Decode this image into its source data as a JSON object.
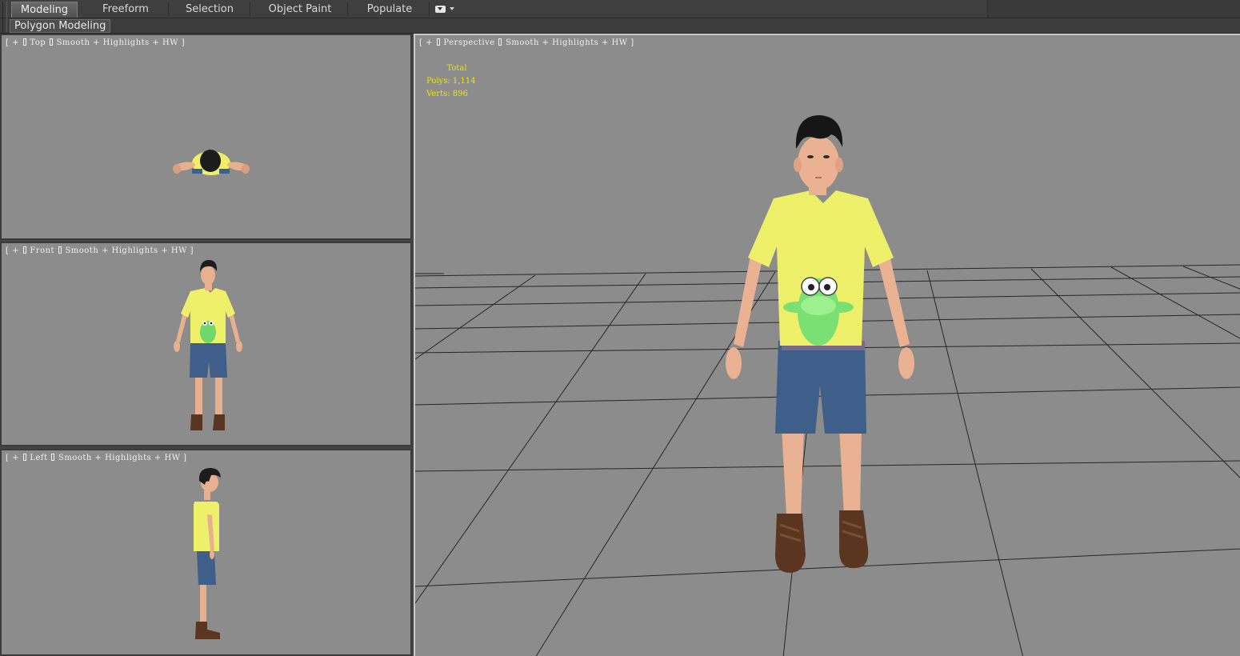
{
  "ribbon": {
    "tabs": [
      {
        "label": "Modeling",
        "active": true
      },
      {
        "label": "Freeform",
        "active": false
      },
      {
        "label": "Selection",
        "active": false
      },
      {
        "label": "Object Paint",
        "active": false
      },
      {
        "label": "Populate",
        "active": false
      }
    ],
    "panel_label": "Polygon Modeling"
  },
  "viewports": {
    "top": {
      "plus": "+",
      "name": "Top",
      "mode": "Smooth + Highlights + HW"
    },
    "front": {
      "plus": "+",
      "name": "Front",
      "mode": "Smooth + Highlights + HW"
    },
    "left": {
      "plus": "+",
      "name": "Left",
      "mode": "Smooth + Highlights + HW"
    },
    "perspective": {
      "plus": "+",
      "name": "Perspective",
      "mode": "Smooth + Highlights + HW"
    }
  },
  "statistics": {
    "header": "Total",
    "polys_label": "Polys:",
    "polys_value": "1,114",
    "verts_label": "Verts:",
    "verts_value": "896"
  },
  "colors": {
    "viewport_bg": "#8c8c8c",
    "stats_text": "#f2e400",
    "shirt": "#eef06a",
    "shorts": "#3e5f8a",
    "frog": "#6fd86a",
    "hair": "#1c1c1c",
    "skin": "#e7b08e",
    "boots": "#5a3520"
  }
}
